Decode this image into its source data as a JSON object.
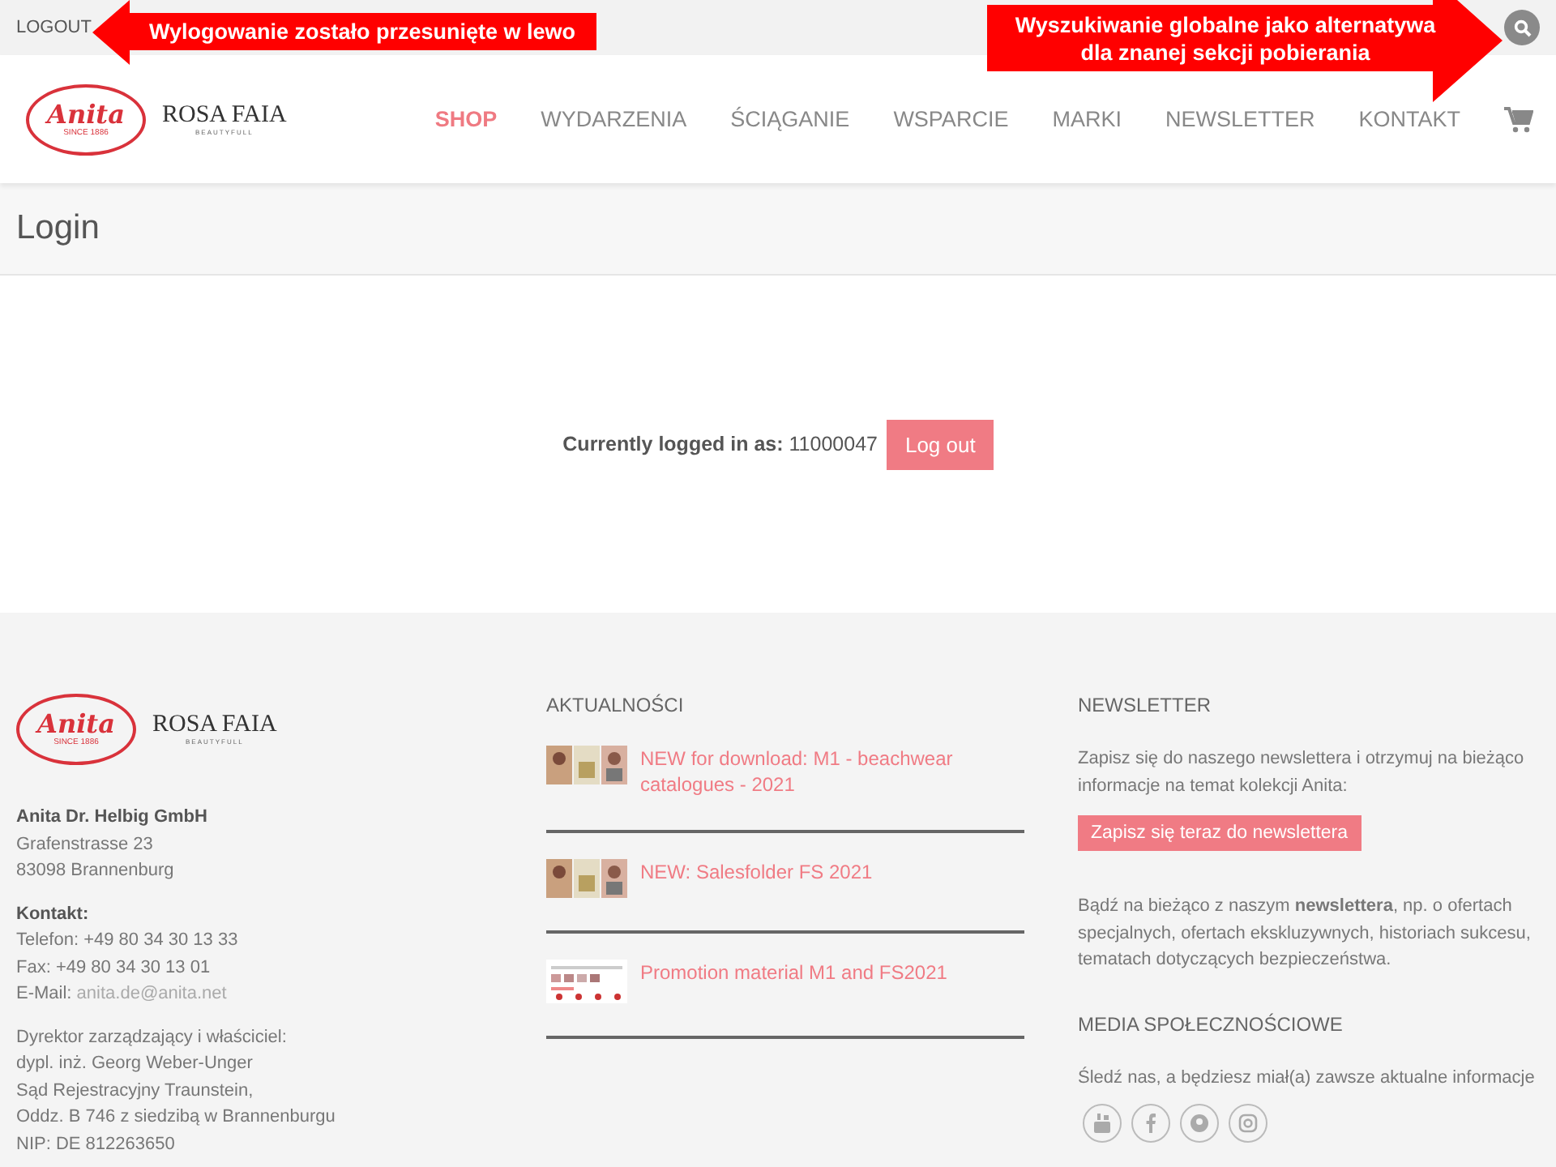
{
  "top_bar": {
    "logout_link": "LOGOUT"
  },
  "annotations": [
    {
      "kind": "left",
      "text": "Wylogowanie zostało przesunięte w lewo"
    },
    {
      "kind": "right",
      "text": "Wyszukiwanie globalne jako alternatywa dla znanej sekcji pobierania"
    }
  ],
  "header_logo": {
    "brand": "Anita",
    "since": "SINCE 1886",
    "second_brand": "ROSA FAIA",
    "tagline": "BEAUTYFULL"
  },
  "footer_logo": {
    "brand": "Anita",
    "since": "SINCE 1886",
    "second_brand": "ROSA FAIA",
    "tagline": "BEAUTYFULL"
  },
  "nav": [
    {
      "label": "SHOP",
      "selected": true
    },
    {
      "label": "WYDARZENIA",
      "selected": false
    },
    {
      "label": "ŚCIĄGANIE",
      "selected": false
    },
    {
      "label": "WSPARCIE",
      "selected": false
    },
    {
      "label": "MARKI",
      "selected": false
    },
    {
      "label": "NEWSLETTER",
      "selected": false
    },
    {
      "label": "KONTAKT",
      "selected": false
    }
  ],
  "page_title": "Login",
  "login": {
    "label": "Currently logged in as:",
    "user": "11000047",
    "button": "Log out"
  },
  "footer": {
    "company": {
      "name": "Anita Dr. Helbig GmbH",
      "address": [
        "Grafenstrasse 23",
        "83098 Brannenburg"
      ],
      "contact_heading": "Kontakt:",
      "phone": "Telefon: +49 80 34 30 13 33",
      "fax": "Fax: +49 80 34 30 13 01",
      "email_label": "E-Mail:",
      "email": "anita.de@anita.net",
      "legal": [
        "Dyrektor zarządzający i właściciel:",
        "dypl. inż. Georg Weber-Unger",
        "Sąd Rejestracyjny Traunstein,",
        "Oddz. B 746 z siedzibą w Brannenburgu",
        "NIP: DE 812263650"
      ]
    },
    "news": {
      "heading": "AKTUALNOŚCI",
      "items": [
        {
          "title": "NEW for download: M1 - beachwear catalogues - 2021",
          "kind": "photos"
        },
        {
          "title": "NEW: Salesfolder FS 2021",
          "kind": "photos"
        },
        {
          "title": "Promotion material M1 and FS2021",
          "kind": "document"
        }
      ]
    },
    "newsletter": {
      "heading": "NEWSLETTER",
      "intro": "Zapisz się do naszego newslettera i otrzymuj na bieżąco informacje na temat kolekcji Anita:",
      "button": "Zapisz się teraz do newslettera",
      "text": "Bądź na bieżąco z naszym **newslettera**, np. o ofertach specjalnych, ofertach ekskluzywnych, historiach sukcesu, tematach dotyczących bezpieczeństwa."
    },
    "social": {
      "heading": "MEDIA SPOŁECZNOŚCIOWE",
      "text": "Śledź nas, a będziesz miał(a) zawsze aktualne informacje",
      "icons": [
        {
          "kind": "youtube"
        },
        {
          "kind": "facebook"
        },
        {
          "kind": "pinterest"
        },
        {
          "kind": "instagram"
        }
      ]
    }
  }
}
